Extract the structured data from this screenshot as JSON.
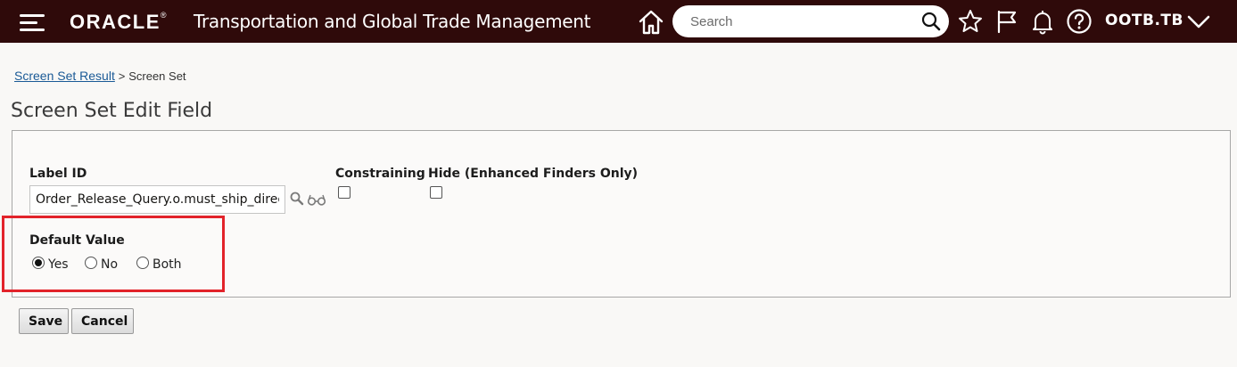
{
  "header": {
    "logo": "ORACLE",
    "logo_mark": "®",
    "app_title": "Transportation and Global Trade Management",
    "search_placeholder": "Search",
    "user": "OOTB.TB"
  },
  "breadcrumb": {
    "link": "Screen Set Result",
    "separator": ">",
    "current": "Screen Set"
  },
  "page": {
    "title": "Screen Set Edit Field"
  },
  "form": {
    "label_id": {
      "label": "Label ID",
      "value": "Order_Release_Query.o.must_ship_direct"
    },
    "constraining": {
      "label": "Constraining",
      "checked": false
    },
    "hide": {
      "label": "Hide (Enhanced Finders Only)",
      "checked": false
    },
    "default_value": {
      "label": "Default Value",
      "options": [
        "Yes",
        "No",
        "Both"
      ],
      "selected": "Yes"
    }
  },
  "buttons": {
    "save": "Save",
    "cancel": "Cancel"
  },
  "colors": {
    "topbar": "#2f0a0a",
    "highlight": "#e2232a",
    "link": "#1a5a96"
  }
}
